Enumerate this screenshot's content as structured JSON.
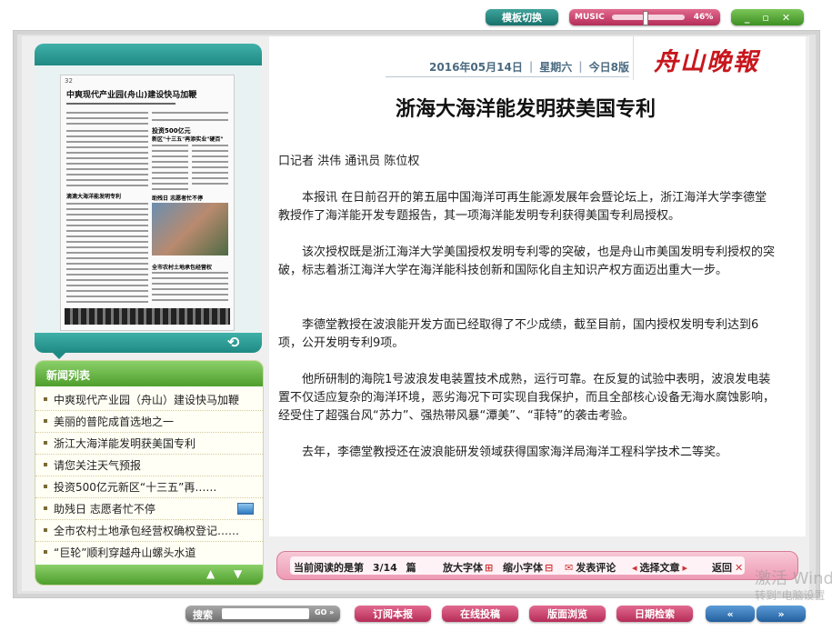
{
  "top": {
    "switch_label": "模板切换",
    "music_label": "MUSIC",
    "music_level": "46%",
    "music_level_value": 0.46
  },
  "thumbnail": {
    "page_label": "32",
    "headline": "中爽现代产业园(舟山)建设快马加鞭",
    "subhead1": "投资500亿元",
    "subhead2": "新区\"十三五\"再添实业\"硬百\"",
    "photo_caption": "助残日 志愿者忙不停",
    "mid_title": "滴滴大海洋能发明专利",
    "bottom_title": "全市农村土地承包经营权"
  },
  "newslist": {
    "title": "新闻列表",
    "items": [
      {
        "label": "中爽现代产业园（舟山）建设快马加鞭",
        "has_image": false
      },
      {
        "label": "美丽的普陀成首选地之一",
        "has_image": false
      },
      {
        "label": "浙江大海洋能发明获美国专利",
        "has_image": false
      },
      {
        "label": "请您关注天气预报",
        "has_image": false
      },
      {
        "label": "投资500亿元新区“十三五”再……",
        "has_image": false
      },
      {
        "label": "助残日 志愿者忙不停",
        "has_image": true
      },
      {
        "label": "全市农村土地承包经营权确权登记……",
        "has_image": false
      },
      {
        "label": "“巨轮”顺利穿越舟山螺头水道",
        "has_image": false
      }
    ]
  },
  "header": {
    "date": "2016年05月14日",
    "weekday": "星期六",
    "edition": "今日8版",
    "masthead": "舟山晚報"
  },
  "article": {
    "title": "浙海大海洋能发明获美国专利",
    "byline": "口记者  洪伟  通讯员  陈位权",
    "paragraphs": [
      "本报讯    在日前召开的第五届中国海洋可再生能源发展年会暨论坛上，浙江海洋大学李德堂教授作了海洋能开发专题报告，其一项海洋能发明专利获得美国专利局授权。",
      "该次授权既是浙江海洋大学美国授权发明专利零的突破，也是舟山市美国发明专利授权的突破，标志着浙江海洋大学在海洋能科技创新和国际化自主知识产权方面迈出重大一步。",
      "李德堂教授在波浪能开发方面已经取得了不少成绩，截至目前，国内授权发明专利达到6项，公开发明专利9项。",
      "他所研制的海院1号波浪发电装置技术成熟，运行可靠。在反复的试验中表明，波浪发电装置不仅适应复杂的海洋环境，恶劣海况下可实现自我保护，而且全部核心设备无海水腐蚀影响，经受住了超强台风“苏力”、强热带风暴“潭美”、“菲特”的袭击考验。",
      "去年，李德堂教授还在波浪能研发领域获得国家海洋局海洋工程科学技术二等奖。"
    ]
  },
  "status": {
    "current_prefix": "当前阅读的是第",
    "current_page": "3/14",
    "current_suffix": "篇",
    "enlarge": "放大字体",
    "shrink": "缩小字体",
    "comment": "发表评论",
    "select": "选择文章",
    "back": "返回"
  },
  "bottombar": {
    "search_label": "搜索",
    "go_label": "GO",
    "subscribe": "订阅本报",
    "submit": "在线投稿",
    "browse": "版面浏览",
    "date_search": "日期检索"
  },
  "watermark": {
    "line1": "激活 Wind",
    "line2": "转到\"电脑设置"
  },
  "colors": {
    "teal": "#1f8a83",
    "pink": "#b52d58",
    "green": "#4e9e2c",
    "blue": "#235f9e"
  }
}
